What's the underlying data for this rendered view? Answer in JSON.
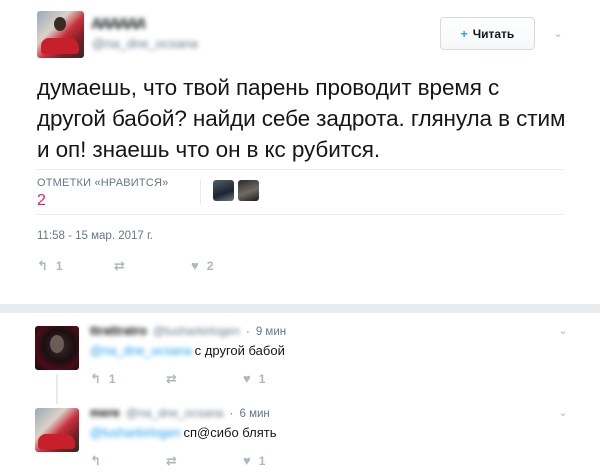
{
  "tweet": {
    "author": {
      "name": "дддддд",
      "handle": "@na_dne_ocsana",
      "avatar": "avatar-icon"
    },
    "follow_button": {
      "label": "Читать",
      "icon": "follow-icon"
    },
    "text": "думаешь, что твой парень проводит время с другой бабой? найди себе задрота. глянула в стим и оп! знаешь что он в кс рубится.",
    "likes_label": "ОТМЕТКИ «НРАВИТСЯ»",
    "likes_count": "2",
    "timestamp": "11:58 - 15 мар. 2017 г.",
    "actions": {
      "reply_count": "1",
      "retweet_count": "",
      "like_count": "2"
    }
  },
  "replies": [
    {
      "name": "ttrattratro",
      "handle": "@lusharkirlogen",
      "dot": "·",
      "time": "9 мин",
      "mention": "@na_dne_ocsana",
      "text": "с другой бабой",
      "actions": {
        "reply_count": "1",
        "retweet_count": "",
        "like_count": "1"
      }
    },
    {
      "name": "mere",
      "handle": "@na_dne_ocsana",
      "dot": "·",
      "time": "6 мин",
      "mention": "@lusharkirlogen",
      "text": "сп@сибо блять",
      "actions": {
        "reply_count": "",
        "retweet_count": "",
        "like_count": "1"
      }
    }
  ],
  "icons": {
    "reply": "↰",
    "retweet": "⇄",
    "like": "♥",
    "caret": "⌄"
  },
  "colors": {
    "accent": "#1da1f2",
    "like": "#e0245e",
    "muted": "#657786",
    "icon": "#aab8c2",
    "divider": "#e6ecf0"
  }
}
